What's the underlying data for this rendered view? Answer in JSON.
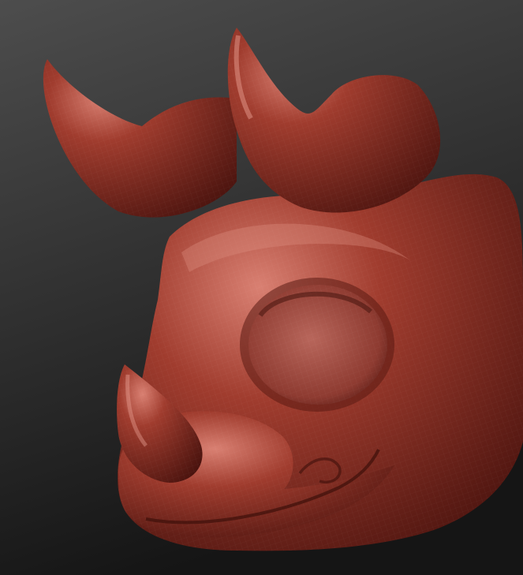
{
  "scene": {
    "background_top": "#4d4d4d",
    "background_bottom": "#151515",
    "clay_color": "#a03c2e",
    "clay_highlight": "#d98072",
    "clay_shadow": "#4a130e"
  }
}
